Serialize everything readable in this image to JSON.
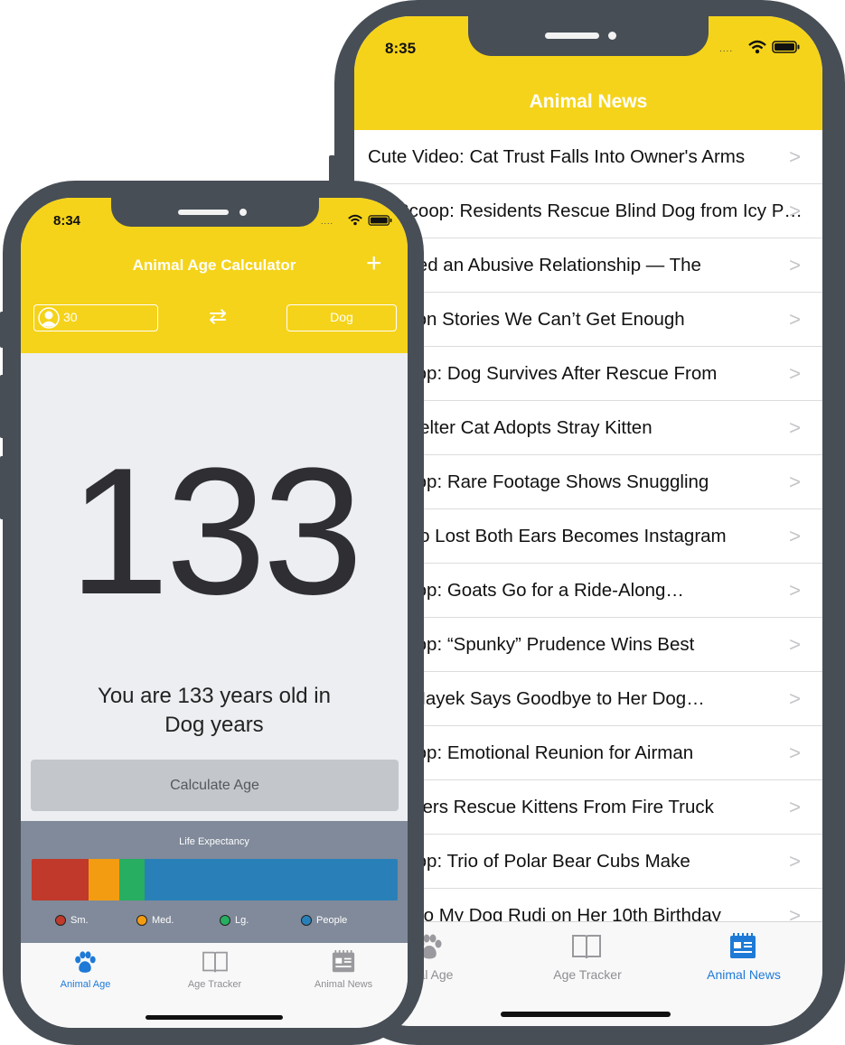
{
  "colors": {
    "frame": "#474e56",
    "header_yellow": "#f5d31a",
    "tab_active": "#1e7ad6",
    "tab_inactive": "#8e8e93",
    "life_panel": "#808a9a"
  },
  "news_phone": {
    "status_time": "8:35",
    "title": "Animal News",
    "articles": [
      "Cute Video: Cat Trust Falls Into Owner's Arms",
      "Scoop: Residents Rescue Blind Dog from Icy Pond",
      "aped an Abusive Relationship — The",
      "ption Stories We Can’t Get Enough",
      "coop: Dog Survives After Rescue From",
      "Shelter Cat Adopts Stray Kitten",
      "coop: Rare Footage Shows Snuggling",
      "Vho Lost Both Ears Becomes Instagram",
      "coop: Goats Go for a Ride-Along…",
      "coop: “Spunky” Prudence Wins Best",
      "a Hayek Says Goodbye to Her Dog…",
      "coop: Emotional Reunion for Airman",
      "ghters Rescue Kittens From Fire Truck",
      "coop: Trio of Polar Bear Cubs Make",
      "er to My Dog Rudi on Her 10th Birthday"
    ],
    "chevron": ">",
    "tabs": [
      {
        "label": "al Age",
        "icon": "paw-icon"
      },
      {
        "label": "Age Tracker",
        "icon": "book-icon"
      },
      {
        "label": "Animal News",
        "icon": "newspaper-icon"
      }
    ],
    "active_tab": 2
  },
  "calc_phone": {
    "status_time": "8:34",
    "title": "Animal Age Calculator",
    "add_symbol": "+",
    "human_age": "30",
    "swap_symbol": "⇄",
    "animal": "Dog",
    "result_age": "133",
    "result_line1": "You are 133 years old in",
    "result_line2": "Dog years",
    "calculate_label": "Calculate Age",
    "life_expectancy": {
      "title": "Life Expectancy",
      "segments": [
        {
          "label": "Sm.",
          "color": "#c0392b",
          "fraction": 0.155
        },
        {
          "label": "Med.",
          "color": "#f39c12",
          "fraction": 0.085
        },
        {
          "label": "Lg.",
          "color": "#27ae60",
          "fraction": 0.07
        },
        {
          "label": "People",
          "color": "#2980b9",
          "fraction": 0.69
        }
      ]
    },
    "tabs": [
      {
        "label": "Animal Age",
        "icon": "paw-icon"
      },
      {
        "label": "Age Tracker",
        "icon": "book-icon"
      },
      {
        "label": "Animal News",
        "icon": "newspaper-icon"
      }
    ],
    "active_tab": 0
  }
}
